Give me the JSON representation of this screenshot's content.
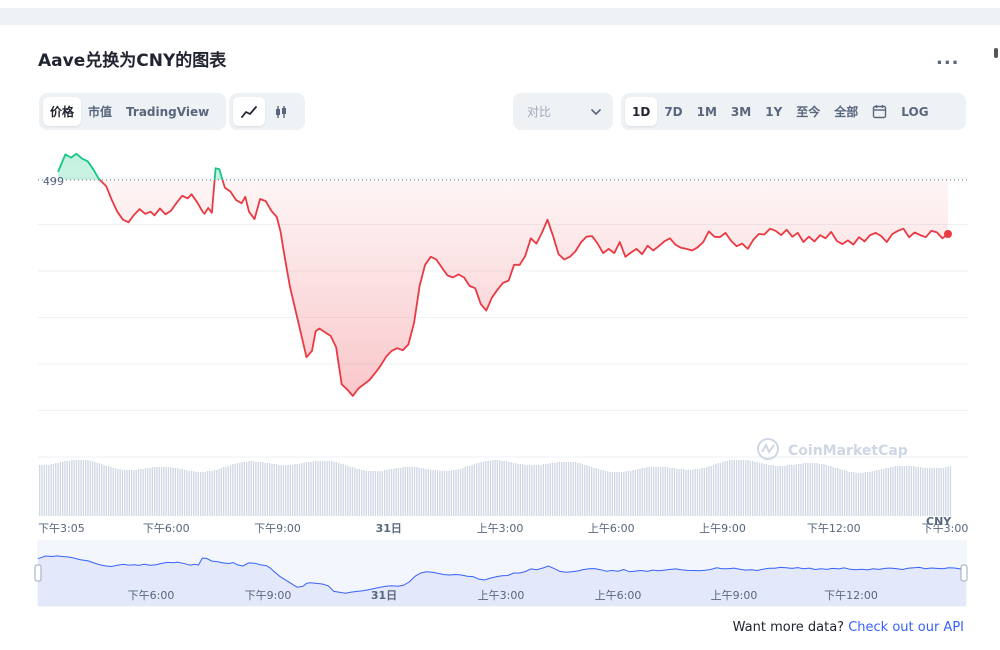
{
  "title": "Aave兑换为CNY的图表",
  "more_label": "...",
  "tabs": {
    "type": [
      "价格",
      "市值",
      "TradingView"
    ],
    "type_active": 0
  },
  "chart_style": {
    "line_icon": "line-chart-icon",
    "candle_icon": "candlestick-icon",
    "active": "line"
  },
  "compare": {
    "label": "对比",
    "icon": "chevron-down-icon"
  },
  "ranges": [
    "1D",
    "7D",
    "1M",
    "3M",
    "1Y",
    "至今",
    "全部"
  ],
  "range_active": "1D",
  "calendar_icon": "calendar-icon",
  "log_label": "LOG",
  "watermark": "CoinMarketCap",
  "currency_label": "CNY",
  "footer": {
    "text": "Want more data?",
    "link": "Check out our API"
  },
  "colors": {
    "up": "#16c784",
    "down": "#ea3943",
    "volume": "#cfd6e4",
    "nav_fill": "#e3e8fb",
    "nav_line": "#3861fb"
  },
  "chart_data": {
    "type": "line",
    "reference_label": "499",
    "x_ticks": [
      "下午3:05",
      "下午6:00",
      "下午9:00",
      "31日",
      "上午3:00",
      "上午6:00",
      "上午9:00",
      "下午12:00",
      "下午3:00"
    ],
    "nav_ticks": [
      "下午6:00",
      "下午9:00",
      "31日",
      "上午3:00",
      "上午6:00",
      "上午9:00",
      "下午12:00"
    ],
    "reference_value": 499,
    "ylim": [
      450,
      505
    ],
    "x_hours": [
      0,
      0.2,
      0.35,
      0.5,
      0.65,
      0.8,
      0.95,
      1.1,
      1.3,
      1.45,
      1.6,
      1.75,
      1.9,
      2.05,
      2.2,
      2.35,
      2.5,
      2.6,
      2.75,
      2.9,
      3.05,
      3.2,
      3.35,
      3.5,
      3.6,
      3.75,
      3.9,
      3.95,
      4.05,
      4.15,
      4.25,
      4.35,
      4.5,
      4.65,
      4.8,
      4.95,
      5.05,
      5.15,
      5.3,
      5.45,
      5.6,
      5.75,
      5.9,
      6.0,
      6.1,
      6.25,
      6.4,
      6.55,
      6.7,
      6.85,
      6.95,
      7.05,
      7.2,
      7.35,
      7.5,
      7.65,
      7.8,
      7.95,
      8.1,
      8.25,
      8.4,
      8.55,
      8.7,
      8.85,
      9.0,
      9.15,
      9.3,
      9.45,
      9.6,
      9.75,
      9.9,
      10.05,
      10.2,
      10.35,
      10.5,
      10.65,
      10.8,
      10.95,
      11.1,
      11.25,
      11.4,
      11.55,
      11.7,
      11.85,
      12.0,
      12.15,
      12.3,
      12.45,
      12.6,
      12.75,
      12.9,
      13.05,
      13.2,
      13.35,
      13.5,
      13.65,
      13.8,
      13.95,
      14.1,
      14.25,
      14.4,
      14.55,
      14.7,
      14.85,
      15.0,
      15.15,
      15.3,
      15.45,
      15.6,
      15.75,
      15.9,
      16.05,
      16.2,
      16.35,
      16.5,
      16.65,
      16.8,
      16.95,
      17.1,
      17.25,
      17.4,
      17.55,
      17.7,
      17.85,
      18.0,
      18.15,
      18.3,
      18.45,
      18.6,
      18.75,
      18.9,
      19.05,
      19.2,
      19.35,
      19.5,
      19.65,
      19.8,
      19.95,
      20.1,
      20.25,
      20.4,
      20.55,
      20.7,
      20.85,
      21.0,
      21.15,
      21.3,
      21.45,
      21.6,
      21.75,
      21.9,
      22.05,
      22.2,
      22.35,
      22.5,
      22.65,
      22.8,
      22.95,
      23.1,
      23.25,
      23.4,
      23.55,
      23.7,
      23.85,
      24.0
    ],
    "prices": [
      500.5,
      503.8,
      503.2,
      503.9,
      503.0,
      502.5,
      501.0,
      499.2,
      497.8,
      495.2,
      493.0,
      491.5,
      491.0,
      492.4,
      493.5,
      492.6,
      493.0,
      492.3,
      493.6,
      492.5,
      493.2,
      494.7,
      496.0,
      495.5,
      496.3,
      494.8,
      493.0,
      492.6,
      493.7,
      492.8,
      501.2,
      501.0,
      497.5,
      496.8,
      495.2,
      494.6,
      495.8,
      493.0,
      491.6,
      495.4,
      495.0,
      493.2,
      492.0,
      489.3,
      485.0,
      479.0,
      474.6,
      470.1,
      465.6,
      466.8,
      470.5,
      471.0,
      470.3,
      469.6,
      467.5,
      460.5,
      459.5,
      458.3,
      459.7,
      460.5,
      461.3,
      462.6,
      464.0,
      465.7,
      466.8,
      467.3,
      466.9,
      468.0,
      472.0,
      479.0,
      483.0,
      484.5,
      484.0,
      482.5,
      481.0,
      480.6,
      481.2,
      480.6,
      479.0,
      478.6,
      475.6,
      474.4,
      476.8,
      478.3,
      479.6,
      480.0,
      483.0,
      483.0,
      484.7,
      488.0,
      487.0,
      489.0,
      491.5,
      488.4,
      485.0,
      484.0,
      484.5,
      485.5,
      487.2,
      488.3,
      488.4,
      487.0,
      485.2,
      486.0,
      485.2,
      487.3,
      484.5,
      485.3,
      486.0,
      485.0,
      486.6,
      485.7,
      486.5,
      487.4,
      488.0,
      486.8,
      486.2,
      486.0,
      485.7,
      486.3,
      487.3,
      489.3,
      488.3,
      488.2,
      489.0,
      487.5,
      486.5,
      487.0,
      486.0,
      487.7,
      488.8,
      488.7,
      489.8,
      489.4,
      488.6,
      489.6,
      488.3,
      489.0,
      487.3,
      488.3,
      487.4,
      488.6,
      488.0,
      489.2,
      487.5,
      486.9,
      487.6,
      486.8,
      488.2,
      487.4,
      488.6,
      489.0,
      488.4,
      487.3,
      488.8,
      489.4,
      489.8,
      488.2,
      489.1,
      488.6,
      488.2,
      489.4,
      489.1,
      488.0,
      488.8
    ]
  }
}
